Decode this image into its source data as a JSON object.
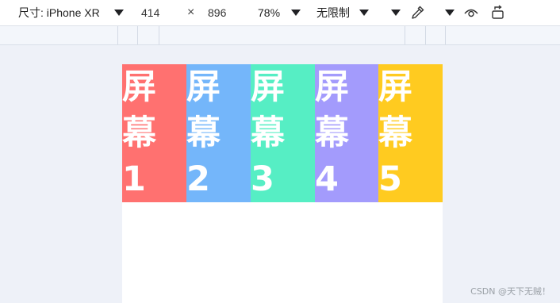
{
  "toolbar": {
    "dimensions_label": "尺寸: iPhone XR",
    "width_value": "414",
    "times_symbol": "×",
    "height_value": "896",
    "zoom_value": "78%",
    "throttle_label": "无限制"
  },
  "icons": {
    "dimensions_dropdown": "chevron-down-icon",
    "zoom_dropdown": "chevron-down-icon",
    "throttle_dropdown": "chevron-down-icon",
    "more_dropdown": "chevron-down-icon",
    "picker": "eyedropper-icon",
    "visibility": "eye-icon",
    "rotate": "rotate-icon"
  },
  "screens": [
    {
      "text1": "屏",
      "text2": "幕",
      "text3": "1",
      "color": "#ff7170"
    },
    {
      "text1": "屏",
      "text2": "幕",
      "text3": "2",
      "color": "#74b6fa"
    },
    {
      "text1": "屏",
      "text2": "幕",
      "text3": "3",
      "color": "#56eec4"
    },
    {
      "text1": "屏",
      "text2": "幕",
      "text3": "4",
      "color": "#a39bfc"
    },
    {
      "text1": "屏",
      "text2": "幕",
      "text3": "5",
      "color": "#ffcb20"
    }
  ],
  "watermark": "CSDN @天下无贼！"
}
